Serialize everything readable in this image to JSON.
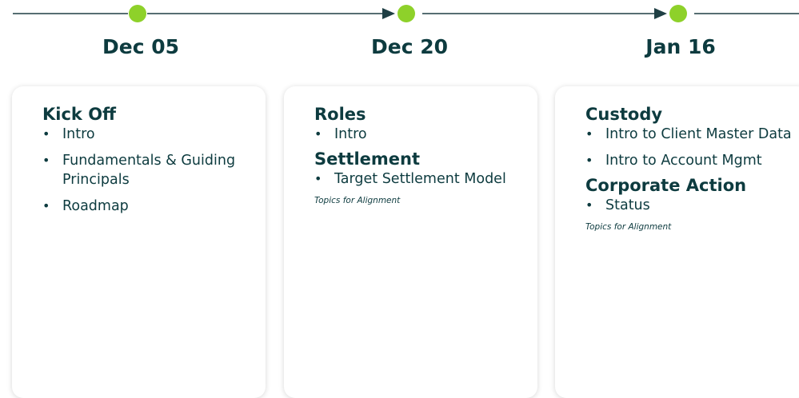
{
  "colors": {
    "line": "#1f3f44",
    "node": "#8ed12a",
    "text": "#0d3b3f"
  },
  "milestones": [
    {
      "date": "Dec 05",
      "sections": [
        {
          "title": "Kick Off",
          "items": [
            "Intro",
            "Fundamentals & Guiding Principals",
            "Roadmap"
          ]
        }
      ],
      "note": ""
    },
    {
      "date": "Dec 20",
      "sections": [
        {
          "title": "Roles",
          "items": [
            "Intro"
          ]
        },
        {
          "title": "Settlement",
          "items": [
            "Target Settlement Model"
          ]
        }
      ],
      "note": "Topics for Alignment"
    },
    {
      "date": "Jan 16",
      "sections": [
        {
          "title": "Custody",
          "items": [
            "Intro to Client Master Data",
            "Intro to Account Mgmt"
          ]
        },
        {
          "title": "Corporate Action",
          "items": [
            "Status"
          ]
        }
      ],
      "note": "Topics for Alignment"
    }
  ]
}
